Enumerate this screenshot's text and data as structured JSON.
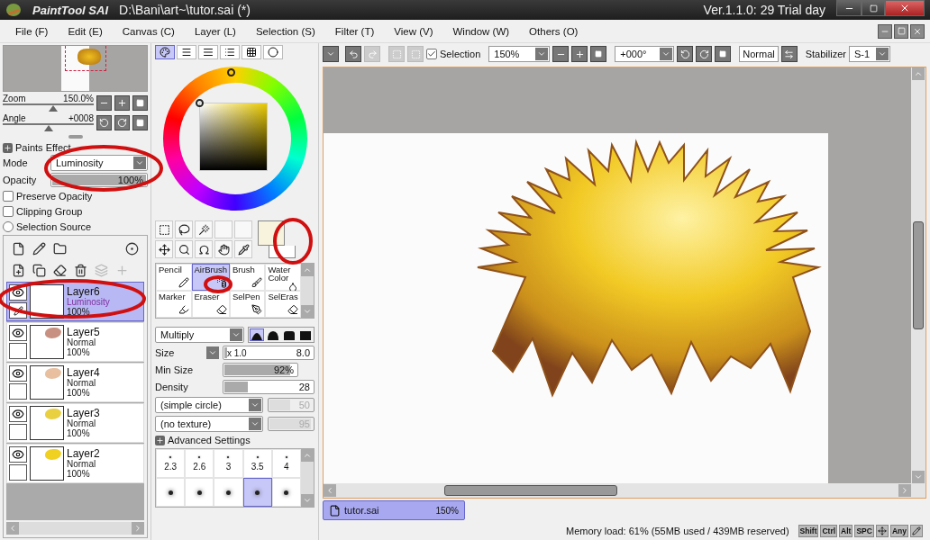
{
  "title_bar": {
    "app_name": "PaintTool SAI",
    "file_path": "D:\\Bani\\art~\\tutor.sai (*)",
    "version": "Ver.1.1.0: 29 Trial day"
  },
  "menu": [
    "File (F)",
    "Edit (E)",
    "Canvas (C)",
    "Layer (L)",
    "Selection (S)",
    "Filter (T)",
    "View (V)",
    "Window (W)",
    "Others (O)"
  ],
  "navigator": {
    "sliders": [
      {
        "label": "Zoom",
        "value": "150.0%",
        "level": 0.55
      },
      {
        "label": "Angle",
        "value": "+0008",
        "level": 0.5
      }
    ]
  },
  "paints_effect": {
    "title": "Paints Effect",
    "mode_label": "Mode",
    "mode": "Luminosity",
    "opacity_label": "Opacity",
    "opacity": {
      "value": "100%",
      "level": 1
    },
    "options": [
      {
        "kind": "checkbox",
        "label": "Preserve Opacity",
        "checked": false
      },
      {
        "kind": "checkbox",
        "label": "Clipping Group",
        "checked": false
      },
      {
        "kind": "radio",
        "label": "Selection Source",
        "checked": false
      }
    ]
  },
  "layers": [
    {
      "name": "Layer6",
      "mode": "Luminosity",
      "opacity": "100%",
      "selected": true,
      "visible": true,
      "edit_target": true
    },
    {
      "name": "Layer5",
      "mode": "Normal",
      "opacity": "100%",
      "selected": false,
      "visible": true,
      "edit_target": false,
      "color": "#c89080"
    },
    {
      "name": "Layer4",
      "mode": "Normal",
      "opacity": "100%",
      "selected": false,
      "visible": true,
      "edit_target": false,
      "color": "#e8c0a0"
    },
    {
      "name": "Layer3",
      "mode": "Normal",
      "opacity": "100%",
      "selected": false,
      "visible": true,
      "edit_target": false,
      "color": "#e8d040"
    },
    {
      "name": "Layer2",
      "mode": "Normal",
      "opacity": "100%",
      "selected": false,
      "visible": true,
      "edit_target": false,
      "color": "#f0d020"
    }
  ],
  "color_tabs": [
    {
      "selected": true
    },
    {
      "selected": false
    },
    {
      "selected": false
    },
    {
      "selected": false
    },
    {
      "selected": false
    },
    {
      "selected": false
    }
  ],
  "swatches": [
    {
      "kind": "secondary",
      "color": "#ffffff"
    },
    {
      "kind": "primary",
      "color": "#f7f3dc"
    }
  ],
  "brushes": [
    {
      "label": "Pencil",
      "selected": false
    },
    {
      "label": "AirBrush",
      "selected": true
    },
    {
      "label": "Brush",
      "selected": false
    },
    {
      "label": "Water Color",
      "selected": false
    },
    {
      "label": "Marker",
      "selected": false
    },
    {
      "label": "Eraser",
      "selected": false
    },
    {
      "label": "SelPen",
      "selected": false
    },
    {
      "label": "SelEras",
      "selected": false
    }
  ],
  "brush_settings": {
    "blend": "Multiply",
    "shapes": [
      {
        "selected": true
      },
      {
        "selected": false
      },
      {
        "selected": false
      },
      {
        "selected": false
      }
    ],
    "sliders": [
      {
        "label": "Size",
        "multiplier": "x 1.0",
        "value": "8.0",
        "level": 0.05
      },
      {
        "label": "Min Size",
        "value": "92%",
        "level": 0.92
      },
      {
        "label": "Density",
        "value": "28",
        "level": 0.28
      }
    ],
    "dropdowns": [
      {
        "value": "(simple circle)",
        "amount": "50",
        "level": 0.5
      },
      {
        "value": "(no texture)",
        "amount": "95",
        "level": 0.95
      }
    ],
    "advanced": "Advanced Settings",
    "presets": [
      {
        "label": "2.3",
        "selected": false
      },
      {
        "label": "2.6",
        "selected": false
      },
      {
        "label": "3",
        "selected": false
      },
      {
        "label": "3.5",
        "selected": false
      },
      {
        "label": "4",
        "selected": false
      },
      {
        "selected": false
      },
      {
        "selected": false
      },
      {
        "selected": false
      },
      {
        "selected": true
      },
      {
        "selected": false
      }
    ]
  },
  "toolbar": {
    "selection_label": "Selection",
    "selection_checked": true,
    "zoom": "150%",
    "angle": "+000°",
    "mode": "Normal",
    "stabilizer_label": "Stabilizer",
    "stabilizer": "S-1"
  },
  "document_tabs": [
    {
      "name": "tutor.sai",
      "zoom": "150%",
      "selected": true
    }
  ],
  "status_bar": {
    "memory": "Memory load: 61% (55MB used / 439MB reserved)",
    "keys": [
      {
        "kind": "key",
        "label": "Shift"
      },
      {
        "kind": "key",
        "label": "Ctrl"
      },
      {
        "kind": "key",
        "label": "Alt"
      },
      {
        "kind": "key",
        "label": "SPC"
      },
      {
        "kind": "move"
      },
      {
        "kind": "key",
        "label": "Any"
      },
      {
        "kind": "pen"
      }
    ]
  }
}
